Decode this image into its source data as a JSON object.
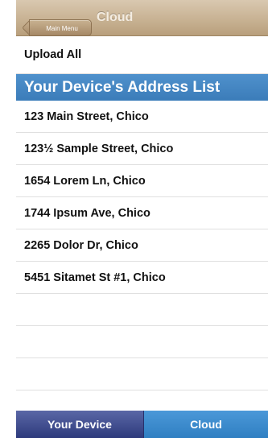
{
  "navbar": {
    "back_label": "Main Menu",
    "title": "Cloud"
  },
  "upload_all_label": "Upload All",
  "section_header": "Your Device's Address List",
  "addresses": [
    "123 Main Street, Chico",
    "123½ Sample Street, Chico",
    "1654 Lorem Ln, Chico",
    "1744 Ipsum Ave, Chico",
    "2265 Dolor Dr, Chico",
    "5451 Sitamet St #1, Chico"
  ],
  "tabs": [
    {
      "label": "Your Device",
      "selected": true
    },
    {
      "label": "Cloud",
      "selected": false
    }
  ],
  "colors": {
    "navbar": "#c8b293",
    "section_header": "#3f82bf",
    "tab_selected": "#2d3a7c",
    "tab_unselected": "#3a8ccf"
  }
}
